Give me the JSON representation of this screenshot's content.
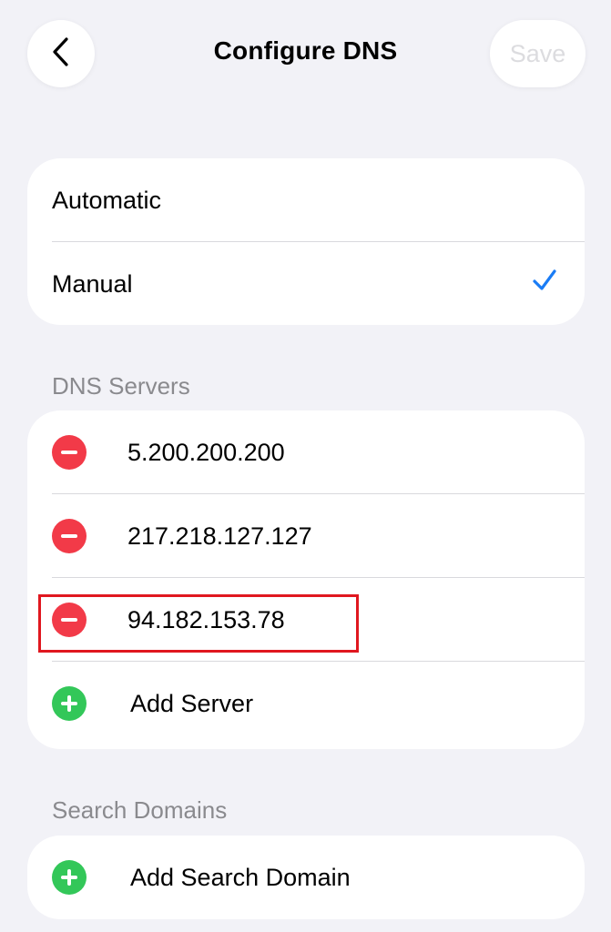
{
  "nav": {
    "back_icon": "chevron-left-icon",
    "title": "Configure DNS",
    "save_label": "Save"
  },
  "mode": {
    "options": [
      {
        "label": "Automatic",
        "selected": false
      },
      {
        "label": "Manual",
        "selected": true
      }
    ],
    "check_icon": "checkmark-icon",
    "accent_color": "#1a7cf5"
  },
  "dns_servers": {
    "header": "DNS Servers",
    "servers": [
      "5.200.200.200",
      "217.218.127.127",
      "94.182.153.78"
    ],
    "add_label": "Add Server",
    "remove_color": "#f23a48",
    "add_color": "#33c759"
  },
  "search_domains": {
    "header": "Search Domains",
    "add_label": "Add Search Domain"
  },
  "highlight": {
    "target": "94.182.153.78",
    "color": "#e0171f"
  }
}
